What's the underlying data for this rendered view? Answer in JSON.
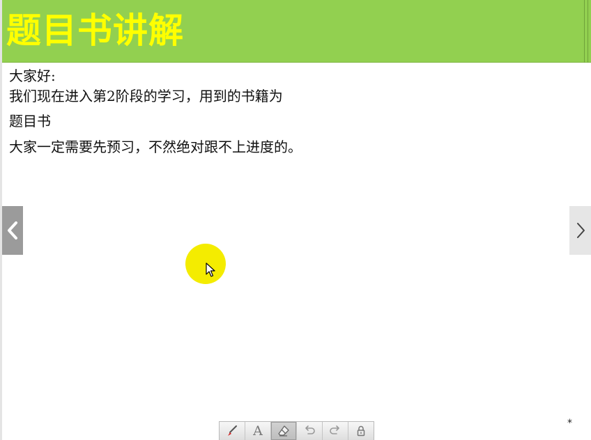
{
  "header": {
    "title": "题目书讲解",
    "title_color": "#ffff00",
    "background_color": "#92d050"
  },
  "content": {
    "lines": [
      "大家好:",
      "我们现在进入第2阶段的学习，用到的书籍为",
      "题目书",
      "大家一定需要先预习，不然绝对跟不上进度的。"
    ]
  },
  "navigation": {
    "prev_icon": "chevron-left-icon",
    "next_icon": "chevron-right-icon"
  },
  "cursor": {
    "highlight_color": "#f4ec00"
  },
  "toolbar": {
    "tools": [
      {
        "name": "pen",
        "icon": "pen-icon",
        "active": false
      },
      {
        "name": "text",
        "icon": "text-icon",
        "label": "A",
        "active": false
      },
      {
        "name": "eraser",
        "icon": "eraser-icon",
        "active": true
      },
      {
        "name": "undo",
        "icon": "undo-icon",
        "active": false
      },
      {
        "name": "redo",
        "icon": "redo-icon",
        "active": false
      },
      {
        "name": "lock",
        "icon": "lock-icon",
        "active": false
      }
    ]
  },
  "footer": {
    "marker": "*"
  }
}
